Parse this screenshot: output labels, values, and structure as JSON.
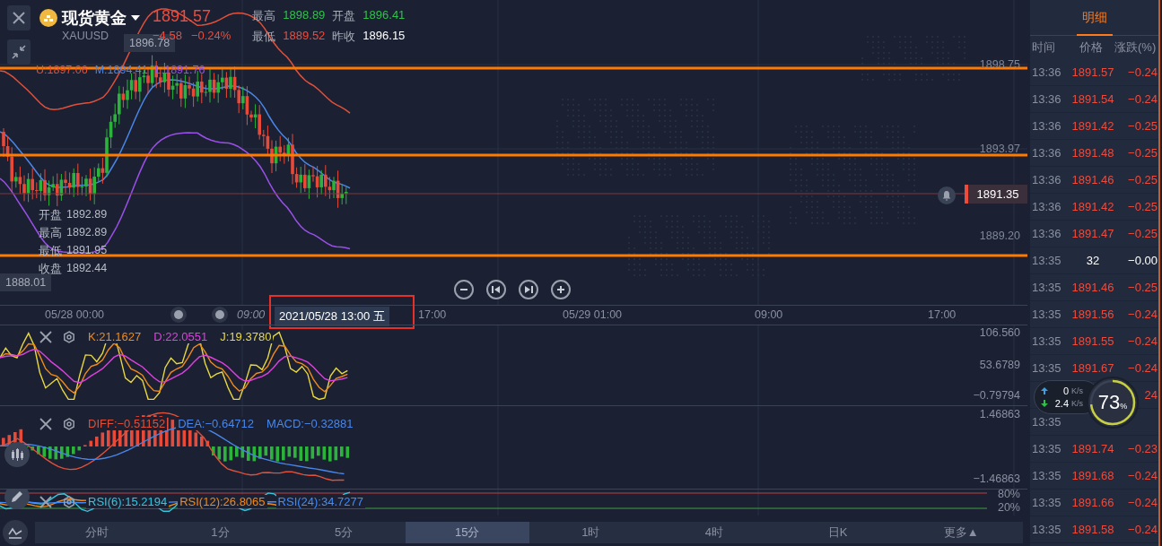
{
  "header": {
    "name": "现货黄金",
    "symbol": "XAUUSD",
    "price": "1891.57",
    "change": "−4.58",
    "change_pct": "−0.24%",
    "stats": [
      {
        "label": "最高",
        "value": "1898.89",
        "color": "#2ec24a"
      },
      {
        "label": "开盘",
        "value": "1896.41",
        "color": "#2ec24a"
      },
      {
        "label": "最低",
        "value": "1889.52",
        "color": "#ee4b3c"
      },
      {
        "label": "昨收",
        "value": "1896.15",
        "color": "#ffffff"
      }
    ]
  },
  "main_chart": {
    "high_marker": "1896.78",
    "low_marker": "1888.01",
    "boll": [
      {
        "text": "U:1897.06",
        "color": "#e0503a"
      },
      {
        "text": "M:1894.41",
        "color": "#4a86e8"
      },
      {
        "text": "L:1891.76",
        "color": "#9a50e8"
      }
    ],
    "y_labels": [
      "1898.75",
      "1893.97",
      "1889.20"
    ],
    "last_price": "1891.35",
    "ohlc": [
      {
        "label": "开盘",
        "value": "1892.89"
      },
      {
        "label": "最高",
        "value": "1892.89"
      },
      {
        "label": "最低",
        "value": "1891.95"
      },
      {
        "label": "收盘",
        "value": "1892.44"
      }
    ]
  },
  "time_axis": {
    "labels": [
      "05/28 00:00",
      "09:00",
      "17:00",
      "05/29 01:00",
      "09:00",
      "17:00"
    ],
    "crosshair_time": "2021/05/28 13:00 五"
  },
  "kdj": {
    "values": [
      {
        "text": "K:21.1627",
        "color": "#f08a1c"
      },
      {
        "text": "D:22.0551",
        "color": "#e040e0"
      },
      {
        "text": "J:19.3780",
        "color": "#e8d840"
      }
    ],
    "y_labels": [
      "106.560",
      "53.6789",
      "−0.79794"
    ]
  },
  "macd": {
    "values": [
      {
        "text": "DIFF:−0.51152",
        "color": "#e0503a"
      },
      {
        "text": "DEA:−0.64712",
        "color": "#4a86e8"
      },
      {
        "text": "MACD:−0.32881",
        "color": "#4a86e8"
      }
    ],
    "y_labels": [
      "1.46863",
      "−1.46863"
    ]
  },
  "rsi": {
    "values": [
      {
        "text": "RSI(6):15.2194",
        "color": "#30c8e0"
      },
      {
        "text": "RSI(12):26.8065",
        "color": "#f08a1c"
      },
      {
        "text": "RSI(24):34.7277",
        "color": "#3f8cff"
      }
    ],
    "y_labels": [
      "80%",
      "20%"
    ]
  },
  "period_tabs": [
    {
      "label": "分时",
      "selected": false
    },
    {
      "label": "1分",
      "selected": false
    },
    {
      "label": "5分",
      "selected": false
    },
    {
      "label": "15分",
      "selected": true
    },
    {
      "label": "1时",
      "selected": false
    },
    {
      "label": "4时",
      "selected": false
    },
    {
      "label": "日K",
      "selected": false
    },
    {
      "label": "更多▲",
      "selected": false
    }
  ],
  "detail": {
    "title": "明细",
    "columns": [
      "时间",
      "价格",
      "涨跌(%)"
    ],
    "rows": [
      {
        "time": "13:36",
        "price": "1891.57",
        "change": "−0.24",
        "color": "#ee4b3c"
      },
      {
        "time": "13:36",
        "price": "1891.54",
        "change": "−0.24",
        "color": "#ee4b3c"
      },
      {
        "time": "13:36",
        "price": "1891.42",
        "change": "−0.25",
        "color": "#ee4b3c"
      },
      {
        "time": "13:36",
        "price": "1891.48",
        "change": "−0.25",
        "color": "#ee4b3c"
      },
      {
        "time": "13:36",
        "price": "1891.46",
        "change": "−0.25",
        "color": "#ee4b3c"
      },
      {
        "time": "13:36",
        "price": "1891.42",
        "change": "−0.25",
        "color": "#ee4b3c"
      },
      {
        "time": "13:36",
        "price": "1891.47",
        "change": "−0.25",
        "color": "#ee4b3c"
      },
      {
        "time": "13:35",
        "price": "32",
        "change": "−0.00",
        "color": "#ffffff"
      },
      {
        "time": "13:35",
        "price": "1891.46",
        "change": "−0.25",
        "color": "#ee4b3c"
      },
      {
        "time": "13:35",
        "price": "1891.56",
        "change": "−0.24",
        "color": "#ee4b3c"
      },
      {
        "time": "13:35",
        "price": "1891.55",
        "change": "−0.24",
        "color": "#ee4b3c"
      },
      {
        "time": "13:35",
        "price": "1891.67",
        "change": "−0.24",
        "color": "#ee4b3c"
      },
      {
        "change": "24",
        "color": "#ee4b3c"
      },
      {
        "time": "13:35"
      },
      {
        "time": "13:35",
        "price": "1891.74",
        "change": "−0.23",
        "color": "#ee4b3c"
      },
      {
        "time": "13:35",
        "price": "1891.68",
        "change": "−0.24",
        "color": "#ee4b3c"
      },
      {
        "time": "13:35",
        "price": "1891.66",
        "change": "−0.24",
        "color": "#ee4b3c"
      },
      {
        "time": "13:35",
        "price": "1891.58",
        "change": "−0.24",
        "color": "#ee4b3c"
      }
    ]
  },
  "speed_widget": {
    "upload": "0",
    "upload_unit": "K/s",
    "download": "2.4",
    "download_unit": "K/s",
    "percent": "73",
    "percent_sign": "%"
  }
}
